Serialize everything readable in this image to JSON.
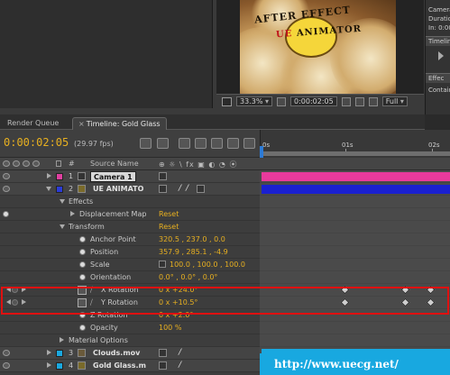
{
  "comp_image": {
    "title_line1": "AFTER EFFECT",
    "title_line2_red": "UE",
    "title_line2_dark": "ANIMATOR"
  },
  "viewer_bar": {
    "zoom": "33.3%",
    "timecode": "0:00:02:05",
    "resolution": "Full"
  },
  "right_panel": {
    "info_lines": [
      "Camera",
      "Duratio",
      "In: 0:00:0"
    ],
    "tab1": "Timeline",
    "tab2": "Effec",
    "contains": "Contain"
  },
  "tabs": {
    "render_queue": "Render Queue",
    "timeline_close": "×",
    "timeline": "Timeline: Gold Glass"
  },
  "timeline_header": {
    "current_time": "0:00:02:05",
    "fps": "(29.97 fps)",
    "ruler_labels": [
      "0s",
      "01s",
      "02s"
    ]
  },
  "columns": {
    "hash": "#",
    "source_name": "Source Name",
    "switches": "⊕ ☼ \\ fx ▣ ◐ ◔ ⦿"
  },
  "layers": [
    {
      "number": "1",
      "name": "Camera 1",
      "label_color": "#e040a0",
      "bar_color": "#e83a9c"
    },
    {
      "number": "2",
      "name": "UE ANIMATO",
      "label_color": "#2b3cd6",
      "bar_color": "#1a20d0"
    },
    {
      "number": "3",
      "name": "Clouds.mov",
      "label_color": "#1aa8e0",
      "bar_color": "#18a8e0"
    },
    {
      "number": "4",
      "name": "Gold Glass.m",
      "label_color": "#1aa8e0",
      "bar_color": "#18a8e0"
    }
  ],
  "properties": {
    "effects": "Effects",
    "displacement_map": "Displacement Map",
    "displacement_reset": "Reset",
    "transform": "Transform",
    "transform_reset": "Reset",
    "anchor_point": {
      "label": "Anchor Point",
      "value": "320.5 , 237.0 , 0.0"
    },
    "position": {
      "label": "Position",
      "value": "357.9 , 285.1 , -4.9"
    },
    "scale": {
      "label": "Scale",
      "value": "100.0 , 100.0 , 100.0"
    },
    "orientation": {
      "label": "Orientation",
      "value": "0.0° , 0.0° , 0.0°"
    },
    "x_rotation": {
      "label": "X Rotation",
      "value": "0 x +24.0°"
    },
    "y_rotation": {
      "label": "Y Rotation",
      "value": "0 x +10.5°"
    },
    "z_rotation": {
      "label": "Z Rotation",
      "value": "0 x +2.0°"
    },
    "opacity": {
      "label": "Opacity",
      "value": "100 %"
    },
    "material_options": "Material Options"
  },
  "watermark": {
    "url": "http://www.uecg.net/"
  },
  "colors": {
    "timecode": "#e8b020",
    "highlight": "#e01010",
    "playhead": "#2d7bd6"
  }
}
